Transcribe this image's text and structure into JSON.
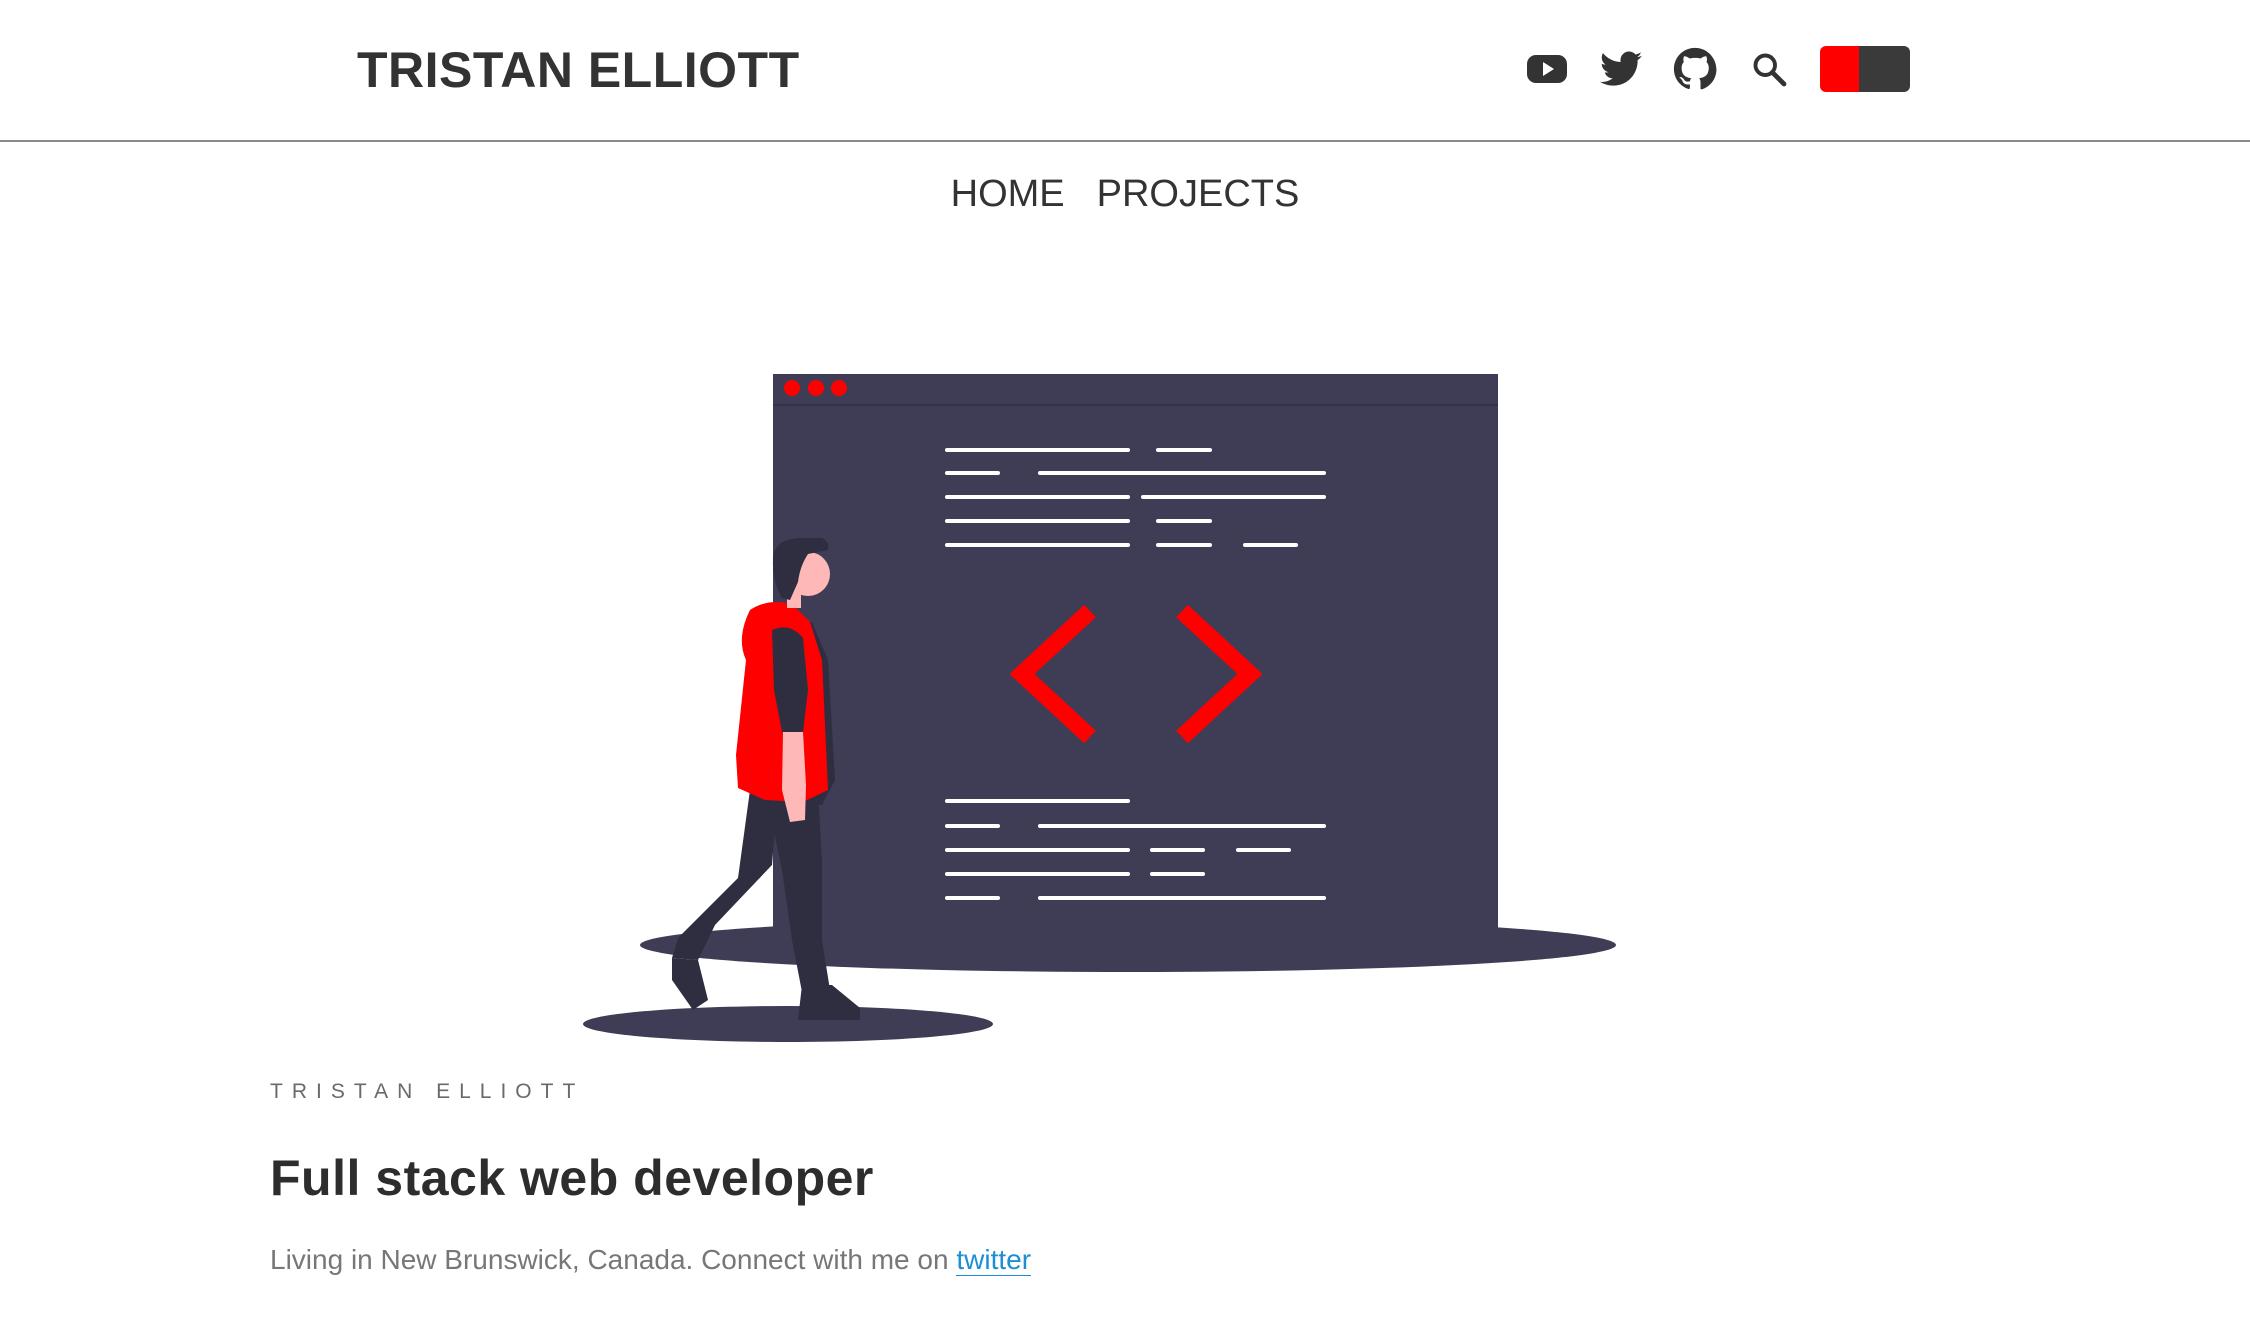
{
  "header": {
    "title": "TRISTAN ELLIOTT",
    "icons": [
      "youtube-icon",
      "twitter-icon",
      "github-icon",
      "search-icon"
    ],
    "theme_toggle": {
      "colors": [
        "#ff0000",
        "#3a3a3a"
      ]
    }
  },
  "nav": {
    "items": [
      {
        "label": "HOME"
      },
      {
        "label": "PROJECTS"
      }
    ]
  },
  "colors": {
    "accent": "#ff0000",
    "screen": "#3f3d56",
    "text": "#333333",
    "link": "#1a8fd6"
  },
  "hero": {
    "illustration": "person-walking-past-code-screen"
  },
  "intro": {
    "overline": "TRISTAN ELLIOTT",
    "headline": "Full stack web developer",
    "bio_text": "Living in New Brunswick, Canada. Connect with me on",
    "bio_link": "twitter"
  }
}
